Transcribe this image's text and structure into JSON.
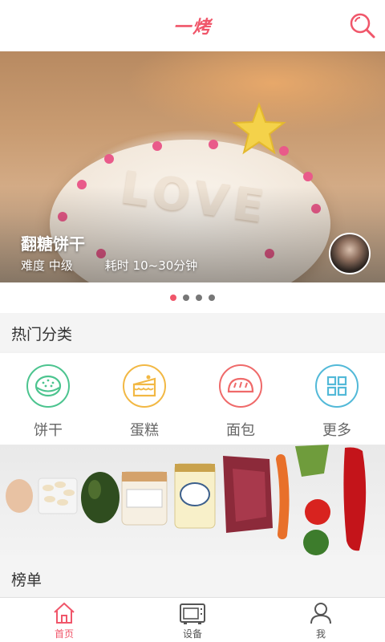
{
  "header": {
    "logo_text": "一烤",
    "search_icon": "search-icon"
  },
  "banner": {
    "title": "翻糖饼干",
    "difficulty": "难度 中级",
    "duration": "耗时 10~30分钟",
    "cake_text": "LOVE",
    "indicator_count": 4,
    "active_index": 0
  },
  "hot_categories": {
    "heading": "热门分类",
    "items": [
      {
        "label": "饼干",
        "icon": "cookie-icon",
        "color": "#4cc48f"
      },
      {
        "label": "蛋糕",
        "icon": "cake-icon",
        "color": "#f2b844"
      },
      {
        "label": "面包",
        "icon": "bread-icon",
        "color": "#ef6a6a"
      },
      {
        "label": "更多",
        "icon": "grid-icon",
        "color": "#52b9d8"
      }
    ]
  },
  "ranking": {
    "heading": "榜单"
  },
  "tabbar": {
    "items": [
      {
        "label": "首页",
        "icon": "home-icon",
        "active": true
      },
      {
        "label": "设备",
        "icon": "oven-icon",
        "active": false
      },
      {
        "label": "我",
        "icon": "user-icon",
        "active": false
      }
    ]
  },
  "colors": {
    "accent": "#f0566a"
  }
}
